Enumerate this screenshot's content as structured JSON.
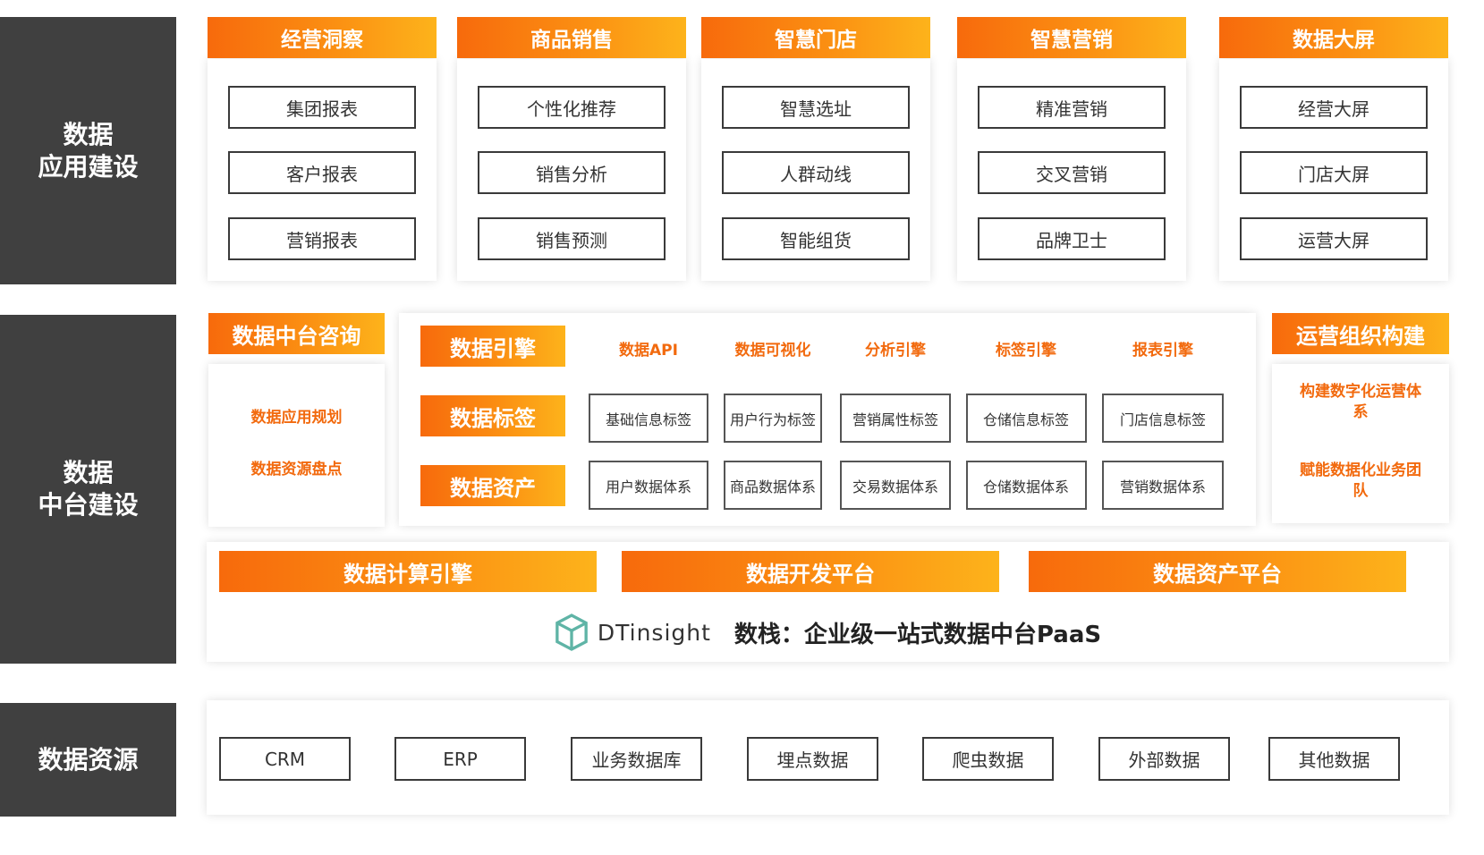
{
  "side_labels": {
    "app_line1": "数据",
    "app_line2": "应用建设",
    "mid_line1": "数据",
    "mid_line2": "中台建设",
    "res": "数据资源"
  },
  "app_columns": [
    {
      "title": "经营洞察",
      "items": [
        "集团报表",
        "客户报表",
        "营销报表"
      ]
    },
    {
      "title": "商品销售",
      "items": [
        "个性化推荐",
        "销售分析",
        "销售预测"
      ]
    },
    {
      "title": "智慧门店",
      "items": [
        "智慧选址",
        "人群动线",
        "智能组货"
      ]
    },
    {
      "title": "智慧营销",
      "items": [
        "精准营销",
        "交叉营销",
        "品牌卫士"
      ]
    },
    {
      "title": "数据大屏",
      "items": [
        "经营大屏",
        "门店大屏",
        "运营大屏"
      ]
    }
  ],
  "consult": {
    "title": "数据中台咨询",
    "items": [
      "数据应用规划",
      "数据资源盘点"
    ]
  },
  "engine": {
    "engine_tag": "数据引擎",
    "label_tag": "数据标签",
    "asset_tag": "数据资产",
    "engine_items": [
      "数据API",
      "数据可视化",
      "分析引擎",
      "标签引擎",
      "报表引擎"
    ],
    "label_items": [
      "基础信息标签",
      "用户行为标签",
      "营销属性标签",
      "仓储信息标签",
      "门店信息标签"
    ],
    "asset_items": [
      "用户数据体系",
      "商品数据体系",
      "交易数据体系",
      "仓储数据体系",
      "营销数据体系"
    ]
  },
  "ops": {
    "title": "运营组织构建",
    "item1": "构建数字化运营体系",
    "item2": "赋能数据化业务团队"
  },
  "platforms": [
    "数据计算引擎",
    "数据开发平台",
    "数据资产平台"
  ],
  "brand": {
    "logo_text": "DTinsight",
    "slogan": "数栈：企业级一站式数据中台PaaS",
    "logo_color": "#5fb4a6"
  },
  "resources": [
    "CRM",
    "ERP",
    "业务数据库",
    "埋点数据",
    "爬虫数据",
    "外部数据",
    "其他数据"
  ],
  "colors": {
    "orange_start": "#f76a0c",
    "orange_end": "#fdb31b",
    "orange_text": "#f26a0e",
    "side_bg": "#404040"
  }
}
